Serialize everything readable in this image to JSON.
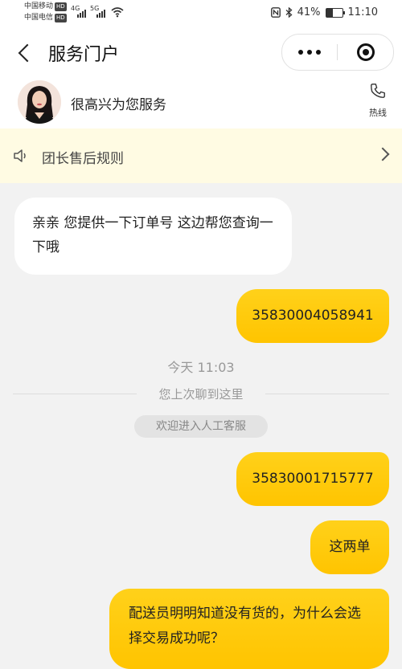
{
  "status_bar": {
    "carrier1": "中国移动",
    "carrier2": "中国电信",
    "hd": "HD",
    "net1": "4G",
    "net2": "5G",
    "battery_text": "41%",
    "battery_level": 0.41,
    "time": "11:10"
  },
  "nav": {
    "title": "服务门户"
  },
  "agent": {
    "greeting": "很高兴为您服务",
    "hotline_label": "热线"
  },
  "notice": {
    "text": "团长售后规则"
  },
  "chat": {
    "msg1": "亲亲 您提供一下订单号 这边帮您查询一下哦",
    "msg2": "35830004058941",
    "time": "今天 11:03",
    "divider": "您上次聊到这里",
    "system": "欢迎进入人工客服",
    "msg3": "35830001715777",
    "msg4": "这两单",
    "msg5": "配送员明明知道没有货的，为什么会选择交易成功呢？"
  },
  "colors": {
    "accent": "#ffc400",
    "notice_bg": "#fffbe3"
  }
}
